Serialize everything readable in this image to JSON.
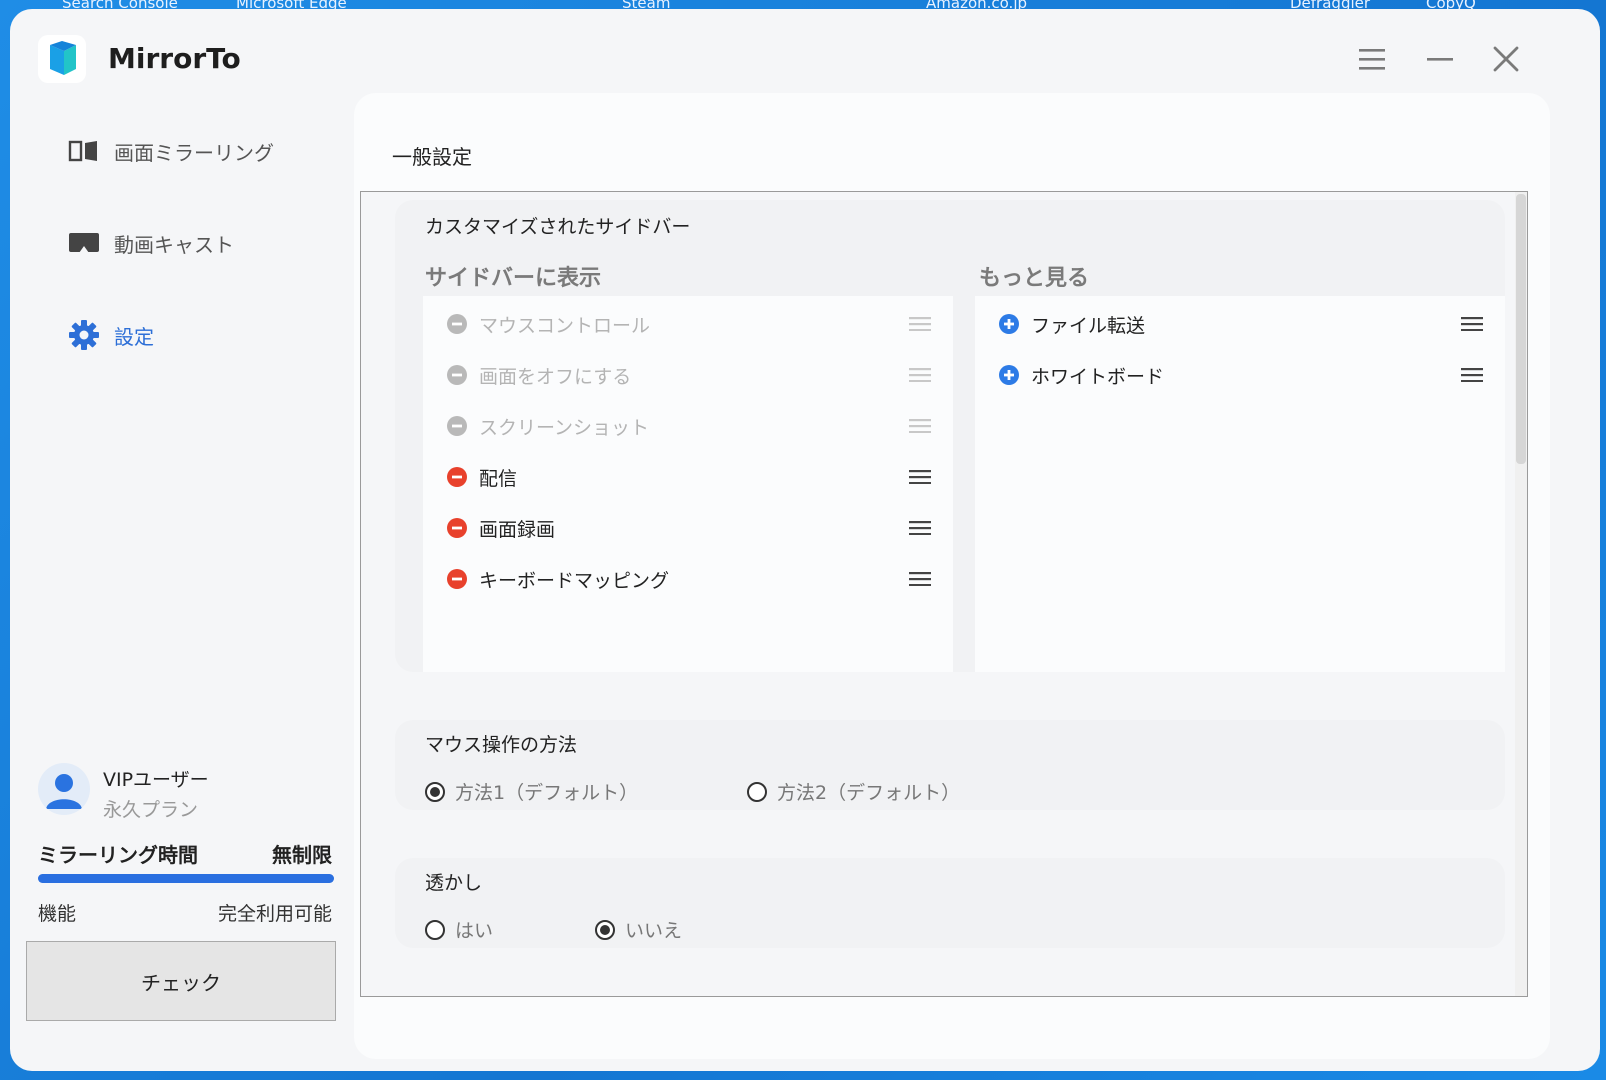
{
  "desktop": {
    "labels": [
      "Search Console",
      "Microsoft Edge",
      "Steam",
      "Amazon.co.jp",
      "Defraggler",
      "CopyQ"
    ]
  },
  "app": {
    "title": "MirrorTo",
    "icons": [
      "menu-icon",
      "minimize-icon",
      "close-icon"
    ]
  },
  "sidebar": {
    "items": [
      {
        "label": "画面ミラーリング",
        "icon": "screen-mirror-icon",
        "active": false
      },
      {
        "label": "動画キャスト",
        "icon": "cast-icon",
        "active": false
      },
      {
        "label": "設定",
        "icon": "gear-icon",
        "active": true
      }
    ],
    "user": {
      "name": "VIPユーザー",
      "plan": "永久プラン",
      "mirror_time_label": "ミラーリング時間",
      "mirror_time_value": "無制限",
      "progress": 1.0,
      "feature_label": "機能",
      "feature_value": "完全利用可能",
      "check_label": "チェック"
    }
  },
  "main": {
    "title": "一般設定",
    "sidebar_custom": {
      "title": "カスタマイズされたサイドバー",
      "shown_header": "サイドバーに表示",
      "more_header": "もっと見る",
      "shown_items": [
        {
          "label": "マウスコントロール",
          "disabled": true
        },
        {
          "label": "画面をオフにする",
          "disabled": true
        },
        {
          "label": "スクリーンショット",
          "disabled": true
        },
        {
          "label": "配信",
          "disabled": false
        },
        {
          "label": "画面録画",
          "disabled": false
        },
        {
          "label": "キーボードマッピング",
          "disabled": false
        }
      ],
      "more_items": [
        {
          "label": "ファイル転送"
        },
        {
          "label": "ホワイトボード"
        }
      ]
    },
    "mouse": {
      "title": "マウス操作の方法",
      "options": [
        "方法1（デフォルト）",
        "方法2（デフォルト）"
      ],
      "selected": 0
    },
    "watermark": {
      "title": "透かし",
      "options": [
        "はい",
        "いいえ"
      ],
      "selected": 1
    }
  },
  "colors": {
    "accent": "#2d6fd7",
    "remove": "#e8412c",
    "add": "#2d7be6",
    "disabled": "#b9b9b9"
  }
}
